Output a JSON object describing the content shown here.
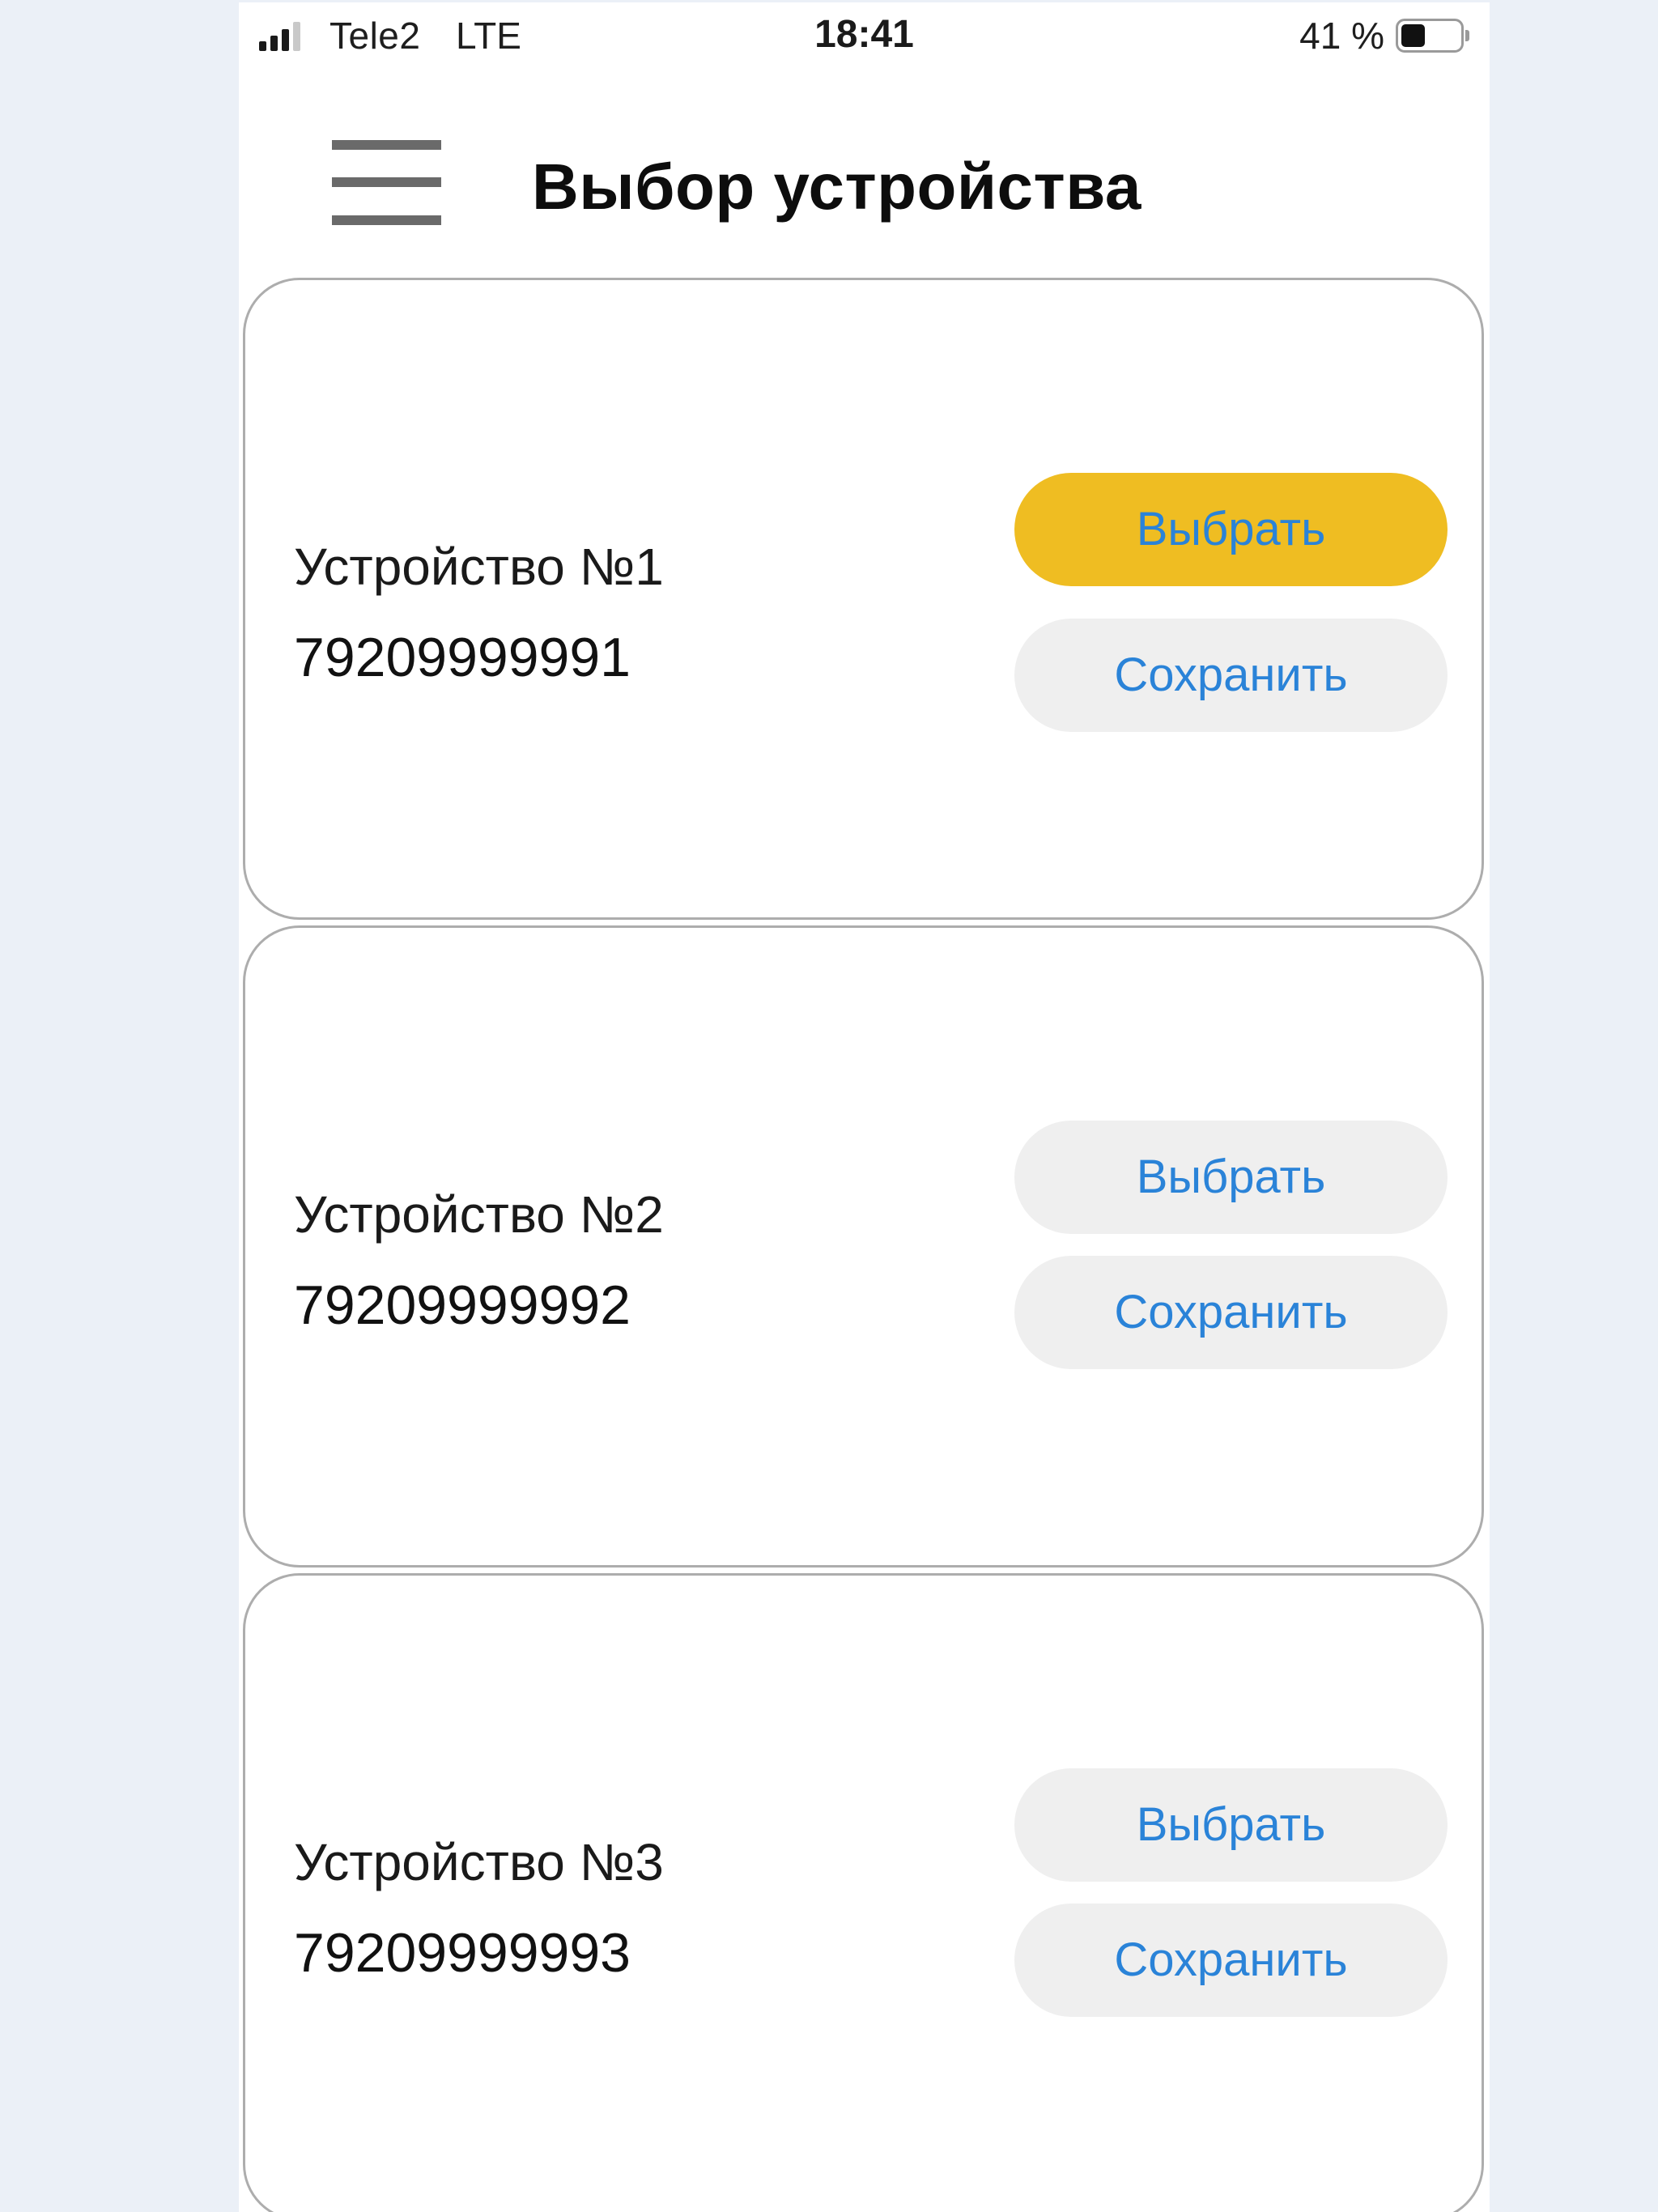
{
  "status_bar": {
    "carrier": "Tele2",
    "network": "LTE",
    "time": "18:41",
    "battery_percent": "41 %",
    "battery_level": 0.41
  },
  "header": {
    "menu_icon": "hamburger-menu-icon",
    "title": "Выбор устройства"
  },
  "devices": [
    {
      "name": "Устройство №1",
      "number": "79209999991",
      "select_label": "Выбрать",
      "save_label": "Сохранить",
      "selected": true
    },
    {
      "name": "Устройство №2",
      "number": "79209999992",
      "select_label": "Выбрать",
      "save_label": "Сохранить",
      "selected": false
    },
    {
      "name": "Устройство №3",
      "number": "79209999993",
      "select_label": "Выбрать",
      "save_label": "Сохранить",
      "selected": false
    }
  ],
  "colors": {
    "page_background": "#ebf0f7",
    "selected_button": "#efbd22",
    "button": "#efefef",
    "button_text": "#2a83d8"
  }
}
